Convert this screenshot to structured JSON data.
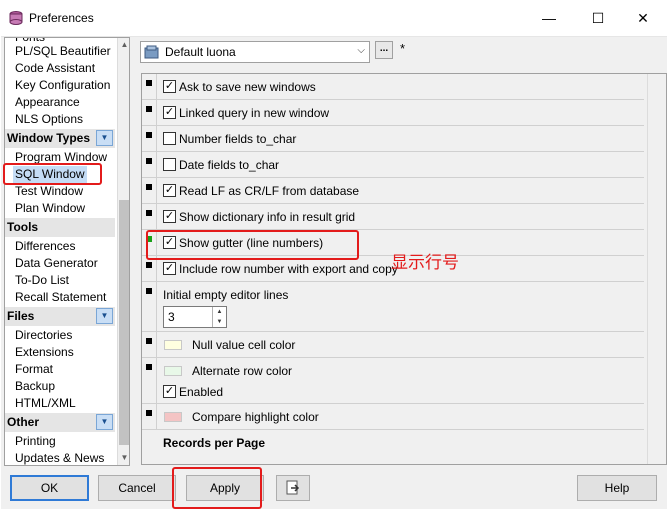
{
  "window": {
    "title": "Preferences",
    "minimize": "—",
    "maximize": "☐",
    "close": "✕"
  },
  "nav": {
    "items_top": [
      "Fonts",
      "PL/SQL Beautifier",
      "Code Assistant",
      "Key Configuration",
      "Appearance",
      "NLS Options"
    ],
    "groups": [
      {
        "label": "Window Types",
        "items": [
          "Program Window",
          "SQL Window",
          "Test Window",
          "Plan Window"
        ]
      },
      {
        "label": "Tools",
        "items": [
          "Differences",
          "Data Generator",
          "To-Do List",
          "Recall Statement"
        ]
      },
      {
        "label": "Files",
        "items": [
          "Directories",
          "Extensions",
          "Format",
          "Backup",
          "HTML/XML"
        ]
      },
      {
        "label": "Other",
        "items": [
          "Printing",
          "Updates & News"
        ]
      }
    ],
    "selected": "SQL Window"
  },
  "profile": {
    "value": "Default luona",
    "ellipsis": "...",
    "modified_mark": "*"
  },
  "options": {
    "ask_save": {
      "label": "Ask to save new windows",
      "checked": true
    },
    "linked_query": {
      "label": "Linked query in new window",
      "checked": true
    },
    "number_to_char": {
      "label": "Number fields to_char",
      "checked": false
    },
    "date_to_char": {
      "label": "Date fields to_char",
      "checked": false
    },
    "read_lf": {
      "label": "Read LF as CR/LF from database",
      "checked": true
    },
    "dict_info": {
      "label": "Show dictionary info in result grid",
      "checked": true
    },
    "show_gutter": {
      "label": "Show gutter (line numbers)",
      "checked": true
    },
    "include_rownum": {
      "label": "Include row number with export and copy",
      "checked": true
    },
    "initial_lines": {
      "label": "Initial empty editor lines",
      "value": "3"
    },
    "null_color": {
      "label": "Null value cell color",
      "color": "#ffffe0"
    },
    "alt_row": {
      "label": "Alternate row color",
      "color": "#e8f8e8",
      "enabled_label": "Enabled",
      "enabled": true
    },
    "compare_highlight": {
      "label": "Compare highlight color",
      "color": "#f4c4c4"
    },
    "records_per_page": {
      "label": "Records per Page"
    }
  },
  "annotation": "显示行号",
  "buttons": {
    "ok": "OK",
    "cancel": "Cancel",
    "apply": "Apply",
    "help": "Help"
  },
  "check_mark": "✓",
  "colors": {
    "accent_red": "#e31b1b",
    "default_btn_border": "#2f7ad6"
  }
}
